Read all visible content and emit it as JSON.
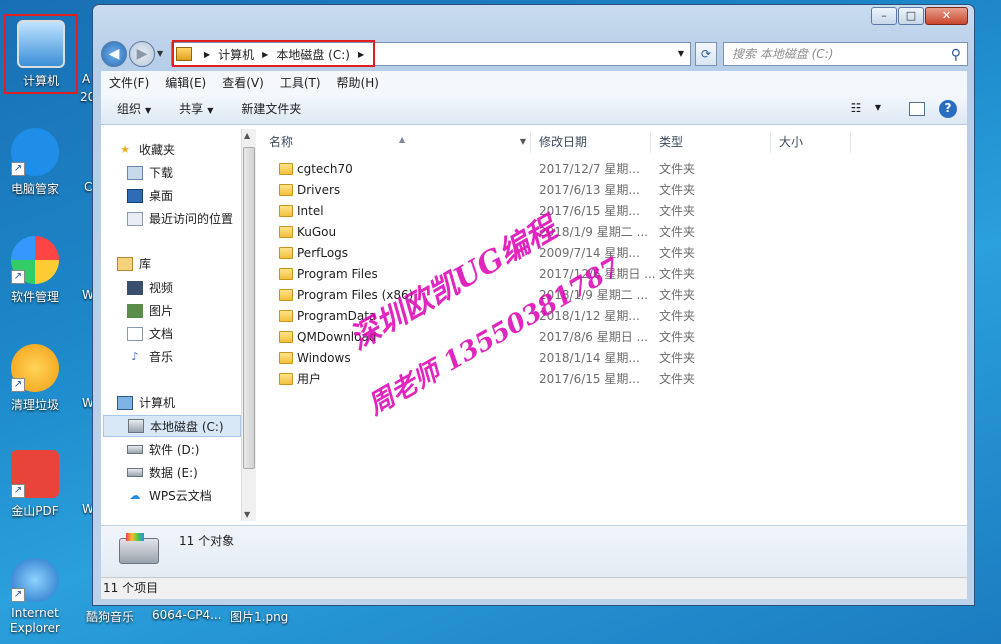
{
  "desktop": {
    "icons": [
      {
        "label": "计算机"
      },
      {
        "label": "电脑管家"
      },
      {
        "label": "软件管理"
      },
      {
        "label": "清理垃圾"
      },
      {
        "label": "金山PDF"
      },
      {
        "label": "Internet Explorer"
      }
    ],
    "partial_labels": [
      "A",
      "20",
      "C",
      "W",
      "W",
      "W"
    ],
    "taskbar_labels": [
      "酷狗音乐",
      "6064-CP4...",
      "图片1.png"
    ]
  },
  "window": {
    "caption_buttons": {
      "minimize": "–",
      "maximize": "□",
      "close": "✕"
    },
    "address": {
      "crumbs": [
        "计算机",
        "本地磁盘 (C:)"
      ]
    },
    "search": {
      "placeholder": "搜索 本地磁盘 (C:)"
    },
    "menu": [
      "文件(F)",
      "编辑(E)",
      "查看(V)",
      "工具(T)",
      "帮助(H)"
    ],
    "toolbar": {
      "organize": "组织",
      "share": "共享",
      "new_folder": "新建文件夹"
    },
    "nav": {
      "favorites": "收藏夹",
      "downloads": "下载",
      "desktop": "桌面",
      "recent": "最近访问的位置",
      "libraries": "库",
      "videos": "视频",
      "pictures": "图片",
      "documents": "文档",
      "music": "音乐",
      "computer": "计算机",
      "drive_c": "本地磁盘 (C:)",
      "drive_d": "软件 (D:)",
      "drive_e": "数据 (E:)",
      "wps": "WPS云文档"
    },
    "columns": {
      "name": "名称",
      "date": "修改日期",
      "type": "类型",
      "size": "大小"
    },
    "files": [
      {
        "name": "cgtech70",
        "date": "2017/12/7 星期...",
        "type": "文件夹"
      },
      {
        "name": "Drivers",
        "date": "2017/6/13 星期...",
        "type": "文件夹"
      },
      {
        "name": "Intel",
        "date": "2017/6/15 星期...",
        "type": "文件夹"
      },
      {
        "name": "KuGou",
        "date": "2018/1/9 星期二 ...",
        "type": "文件夹"
      },
      {
        "name": "PerfLogs",
        "date": "2009/7/14 星期...",
        "type": "文件夹"
      },
      {
        "name": "Program Files",
        "date": "2017/12/6 星期日 ...",
        "type": "文件夹"
      },
      {
        "name": "Program Files (x86)",
        "date": "2018/1/9 星期二 ...",
        "type": "文件夹"
      },
      {
        "name": "ProgramData",
        "date": "2018/1/12 星期...",
        "type": "文件夹"
      },
      {
        "name": "QMDownload",
        "date": "2017/8/6 星期日 ...",
        "type": "文件夹"
      },
      {
        "name": "Windows",
        "date": "2018/1/14 星期...",
        "type": "文件夹"
      },
      {
        "name": "用户",
        "date": "2017/6/15 星期...",
        "type": "文件夹"
      }
    ],
    "details": {
      "count": "11 个对象"
    },
    "status": "11 个项目"
  },
  "watermark": {
    "line1": "深圳欧凯UG编程",
    "line2": "周老师 13550381787"
  }
}
